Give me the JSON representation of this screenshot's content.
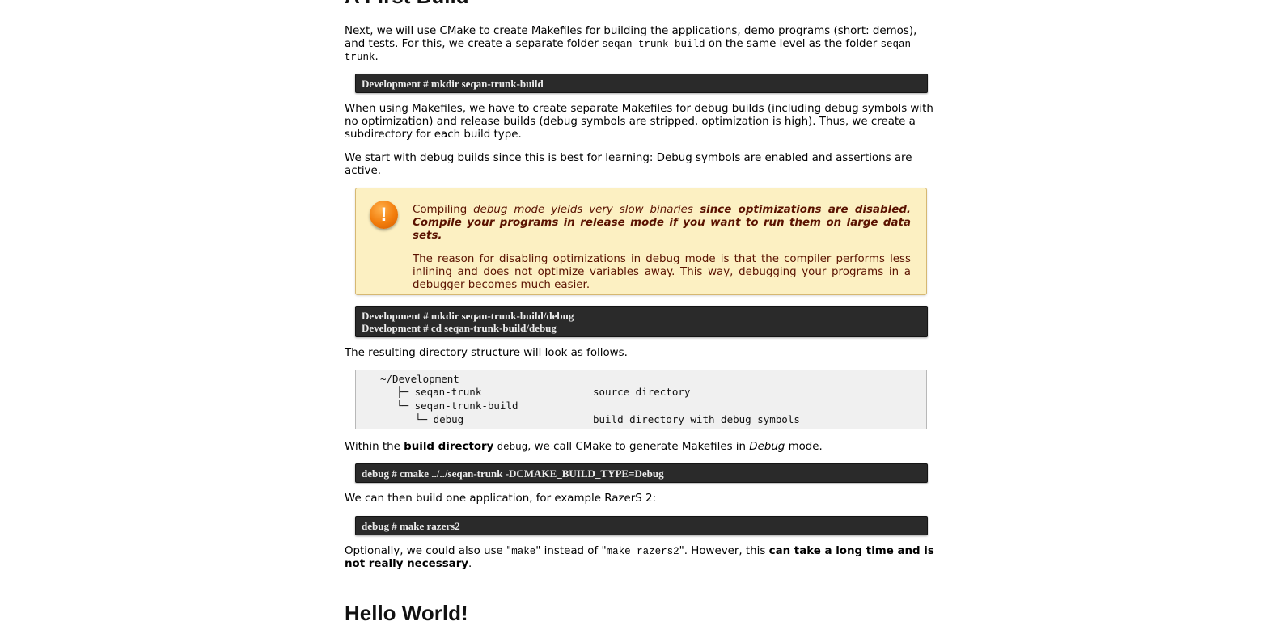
{
  "section_heading_partial": "A First Build",
  "intro": {
    "text_a": "Next, we will use CMake to create Makefiles for building the applications, demo programs (short: demos), and tests. For this, we create a separate folder ",
    "code_a": "seqan-trunk-build",
    "text_b": " on the same level as the folder ",
    "code_b": "seqan-trunk",
    "text_c": "."
  },
  "cmd_mkdir_build": "Development # mkdir seqan-trunk-build",
  "para_makefiles": "When using Makefiles, we have to create separate Makefiles for debug builds (including debug symbols with no optimization) and release builds (debug symbols are stripped, optimization is high). Thus, we create a subdirectory for each build type.",
  "para_debug": "We start with debug builds since this is best for learning: Debug symbols are enabled and assertions are active.",
  "warning": {
    "icon_glyph": "!",
    "line1_a": "Compiling ",
    "line1_italic": "debug mode yields very slow binaries",
    "line1_bold_italic": " since optimizations are disabled. Compile your programs in release mode if you want to run them on large data sets.",
    "line2": "The reason for disabling optimizations in debug mode is that the compiler performs less inlining and does not optimize variables away. This way, debugging your programs in a debugger becomes much easier."
  },
  "cmd_debug_dir": {
    "line1": "Development # mkdir seqan-trunk-build/debug",
    "line2": "Development # cd seqan-trunk-build/debug"
  },
  "para_structure": "The resulting directory structure will look as follows.",
  "tree": {
    "root": "~/Development",
    "item1": "├─ seqan-trunk",
    "item1_desc": "source directory",
    "item2": "└─ seqan-trunk-build",
    "item3": "└─ debug",
    "item3_desc": "build directory with debug symbols"
  },
  "para_within": {
    "text_a": "Within the ",
    "bold": "build directory",
    "code": "debug",
    "text_b": ", we call CMake to generate Makefiles in ",
    "italic": "Debug",
    "text_c": " mode."
  },
  "cmd_cmake": "debug # cmake ../../seqan-trunk -DCMAKE_BUILD_TYPE=Debug",
  "para_build_one": "We can then build one application, for example RazerS 2:",
  "cmd_make": "debug # make razers2",
  "para_optional": {
    "text_a": "Optionally, we could also use \"",
    "code_a": "make",
    "text_b": "\" instead of \"",
    "code_b": "make razers2",
    "text_c": "\". However, this ",
    "bold": "can take a long time and is not really necessary",
    "text_d": "."
  },
  "heading_hello": "Hello World!"
}
